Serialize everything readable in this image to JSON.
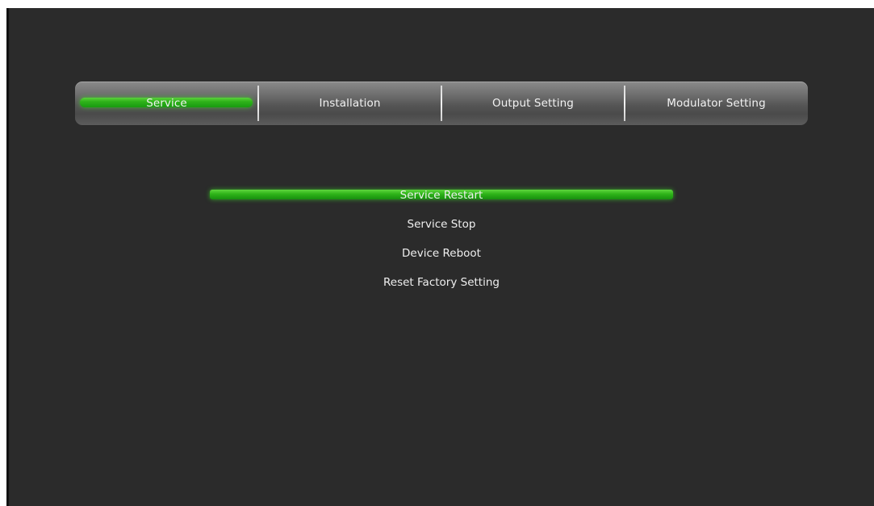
{
  "colors": {
    "background": "#2b2b2b",
    "tabbar": "#6f6f6f",
    "highlight": "#2fb31a",
    "text": "#efefef"
  },
  "tabs": [
    {
      "label": "Service",
      "selected": true
    },
    {
      "label": "Installation",
      "selected": false
    },
    {
      "label": "Output  Setting",
      "selected": false
    },
    {
      "label": "Modulator  Setting",
      "selected": false
    }
  ],
  "menu": {
    "items": [
      {
        "label": "Service  Restart",
        "selected": true
      },
      {
        "label": "Service  Stop",
        "selected": false
      },
      {
        "label": "Device  Reboot",
        "selected": false
      },
      {
        "label": "Reset  Factory  Setting",
        "selected": false
      }
    ]
  }
}
